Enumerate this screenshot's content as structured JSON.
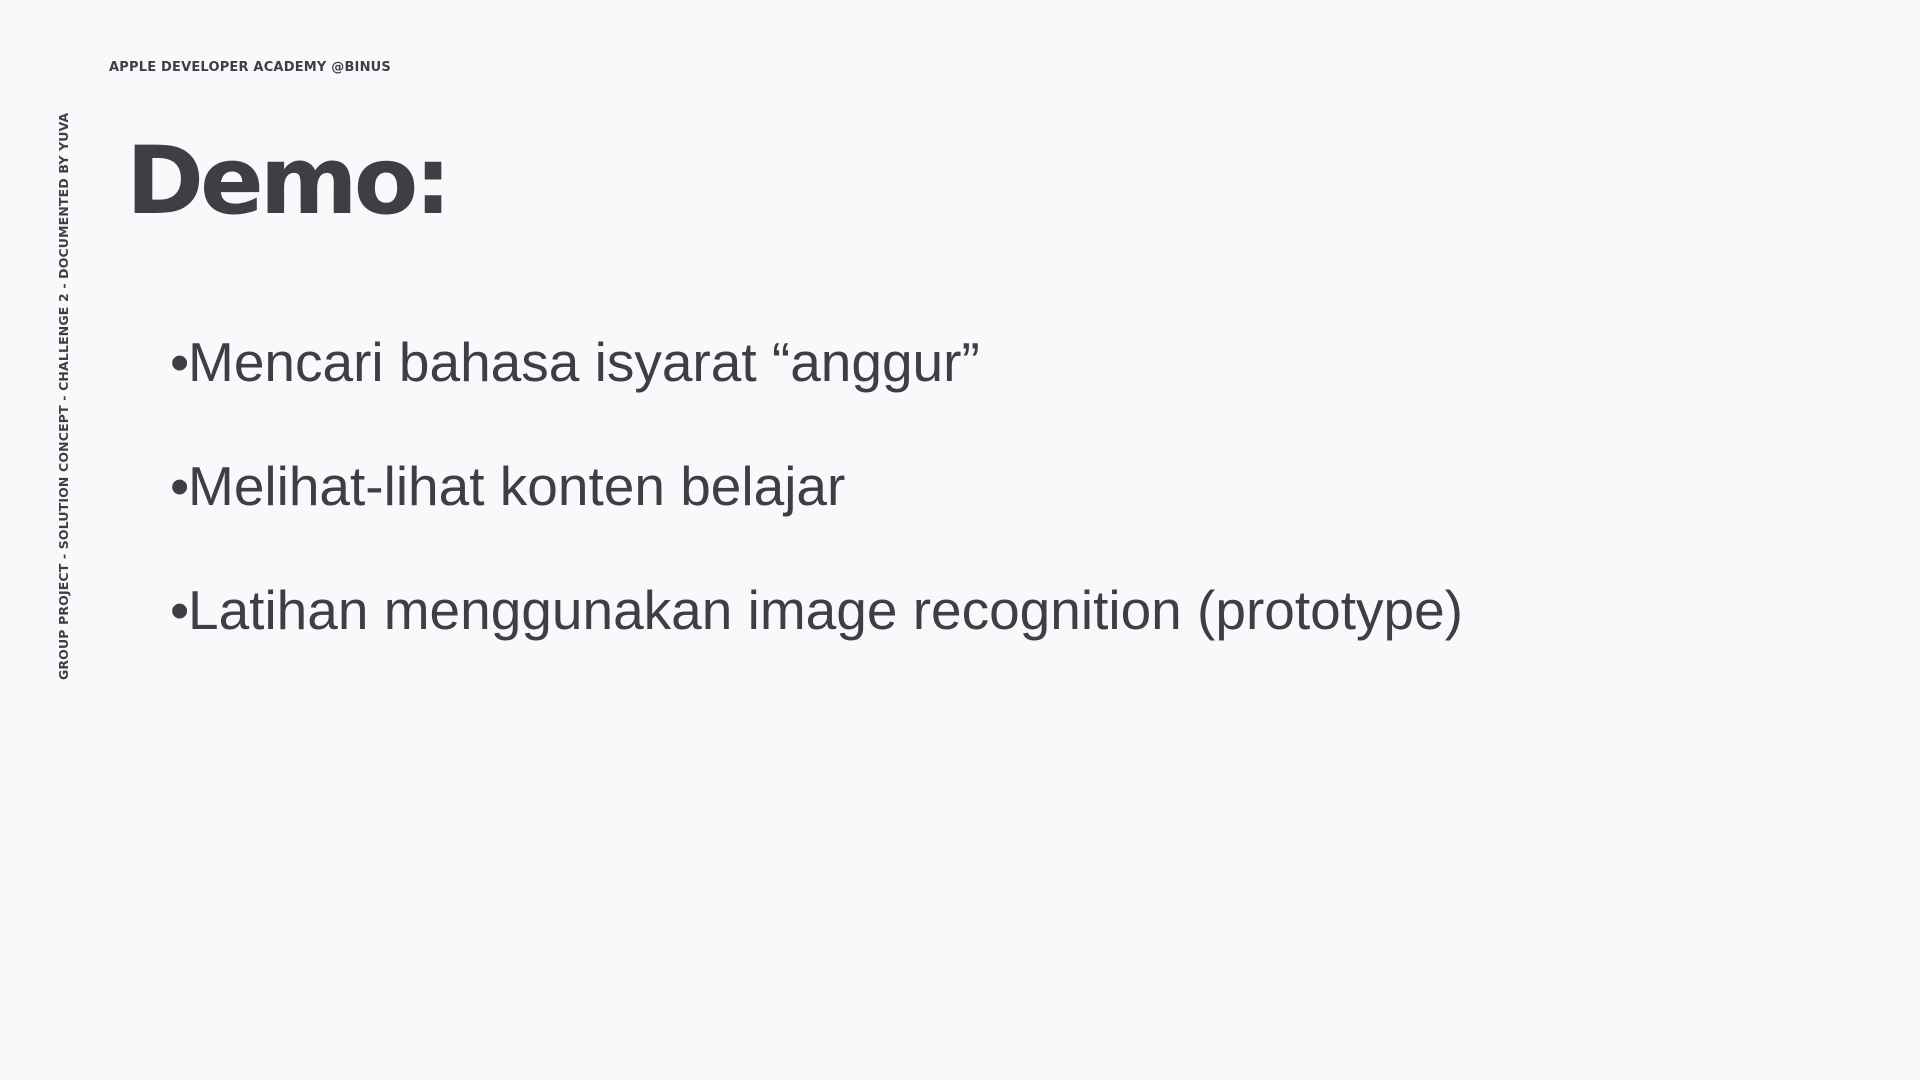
{
  "slide": {
    "org_header": "APPLE DEVELOPER ACADEMY @BINUS",
    "side_label": "GROUP PROJECT - SOLUTION CONCEPT - CHALLENGE 2 - DOCUMENTED BY YUVA",
    "title": "Demo:",
    "bullet_glyph": "•",
    "bullets": [
      "Mencari bahasa isyarat “anggur”",
      "Melihat-lihat konten belajar",
      "Latihan menggunakan image recognition (prototype)"
    ]
  }
}
